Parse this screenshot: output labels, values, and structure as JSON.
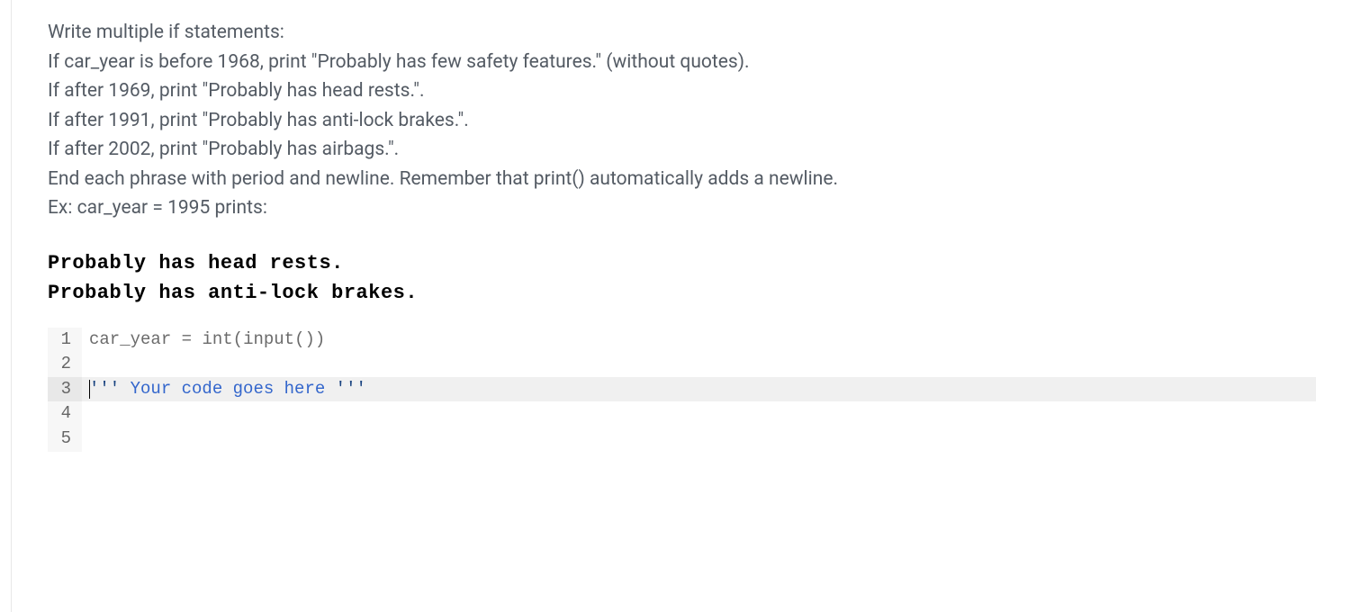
{
  "instructions": {
    "line1": "Write multiple if statements:",
    "line2": "If car_year is before 1968, print \"Probably has few safety features.\" (without quotes).",
    "line3": "If after 1969, print \"Probably has head rests.\".",
    "line4": "If after 1991, print \"Probably has anti-lock brakes.\".",
    "line5": "If after 2002, print \"Probably has airbags.\".",
    "line6": "End each phrase with period and newline. Remember that print() automatically adds a newline.",
    "line7": "Ex: car_year = 1995 prints:"
  },
  "example_output": {
    "line1": "Probably has head rests.",
    "line2": "Probably has anti-lock brakes."
  },
  "code": {
    "lines": [
      {
        "num": "1",
        "highlighted": false
      },
      {
        "num": "2",
        "highlighted": false
      },
      {
        "num": "3",
        "highlighted": true
      },
      {
        "num": "4",
        "highlighted": false
      },
      {
        "num": "5",
        "highlighted": false
      }
    ],
    "line1": {
      "var": "car_year",
      "op": " = ",
      "func1": "int",
      "paren1": "(",
      "func2": "input",
      "paren2": "())"
    },
    "line3": {
      "quote1": "'''",
      "content": " Your code goes here ",
      "quote2": "'''"
    }
  }
}
